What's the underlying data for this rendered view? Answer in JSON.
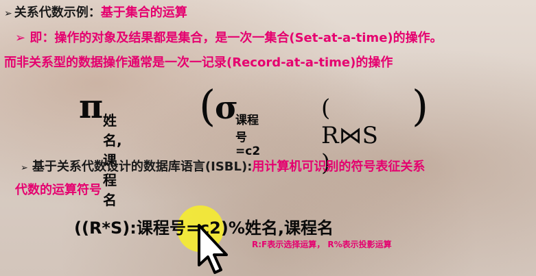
{
  "slide": {
    "line1": {
      "bullet": "➢",
      "label": "关系代数示例：",
      "emphasis": "基于集合的运算"
    },
    "line2": "➢ 即：操作的对象及结果都是集合，是一次一集合(Set-at-a-time)的操作。",
    "line3": "而非关系型的数据操作通常是一次一记录(Record-at-a-time)的操作",
    "formula1": {
      "pi": "π",
      "projection_attrs": "姓名,课程名",
      "open_paren": "(",
      "sigma": "σ",
      "selection_cond": "课程号=c2",
      "inner": "( R⋈S )",
      "close_paren": ")"
    },
    "line4": {
      "bullet": "➢",
      "label": "基于关系代数设计的数据库语言(ISBL):",
      "emphasis": "用计算机可识别的符号表征关系"
    },
    "line5": "代数的运算符号",
    "formula2": "((R*S):课程号=c2)%姓名,课程名",
    "note": "R:F表示选择运算，  R%表示投影运算"
  },
  "colors": {
    "emphasis": "#e5006f",
    "text": "#1a1a1a",
    "cursor_highlight": "#f8ee28"
  },
  "icons": {
    "cursor": "mouse-pointer-icon"
  }
}
